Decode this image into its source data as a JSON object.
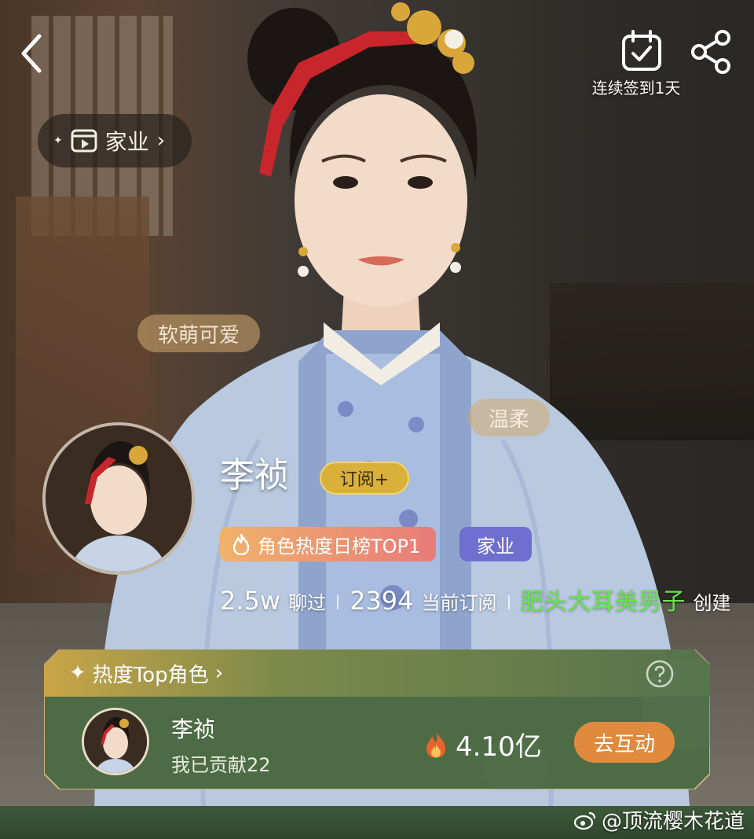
{
  "header": {
    "checkin_label": "连续签到1天"
  },
  "source_pill": {
    "label": "家业"
  },
  "floating_tags": [
    "软萌可爱",
    "温柔"
  ],
  "character": {
    "name": "李祯",
    "subscribe_label": "订阅+",
    "rank_badge": "角色热度日榜TOP1",
    "source_badge": "家业",
    "chats_count": "2.5w",
    "chats_label": "聊过",
    "subscribers_count": "2394",
    "subscribers_label": "当前订阅",
    "creator_name": "肥头大耳美男子",
    "creator_suffix": "创建"
  },
  "hot_card": {
    "title": "热度Top角色",
    "row": {
      "name": "李祯",
      "contribution": "我已贡献22",
      "heat": "4.10亿",
      "action_label": "去互动"
    }
  },
  "watermark": "@顶流樱木花道",
  "colors": {
    "creator_green": "#67e34a",
    "subscribe_gold": "#d9b13a",
    "source_badge": "#6f6fd0",
    "card_green": "#4d6b45",
    "interact_orange": "#e08a3e"
  },
  "icons": [
    "back-icon",
    "calendar-check-icon",
    "share-icon",
    "video-icon",
    "fire-icon",
    "sparkle-icon",
    "help-icon",
    "weibo-icon"
  ]
}
